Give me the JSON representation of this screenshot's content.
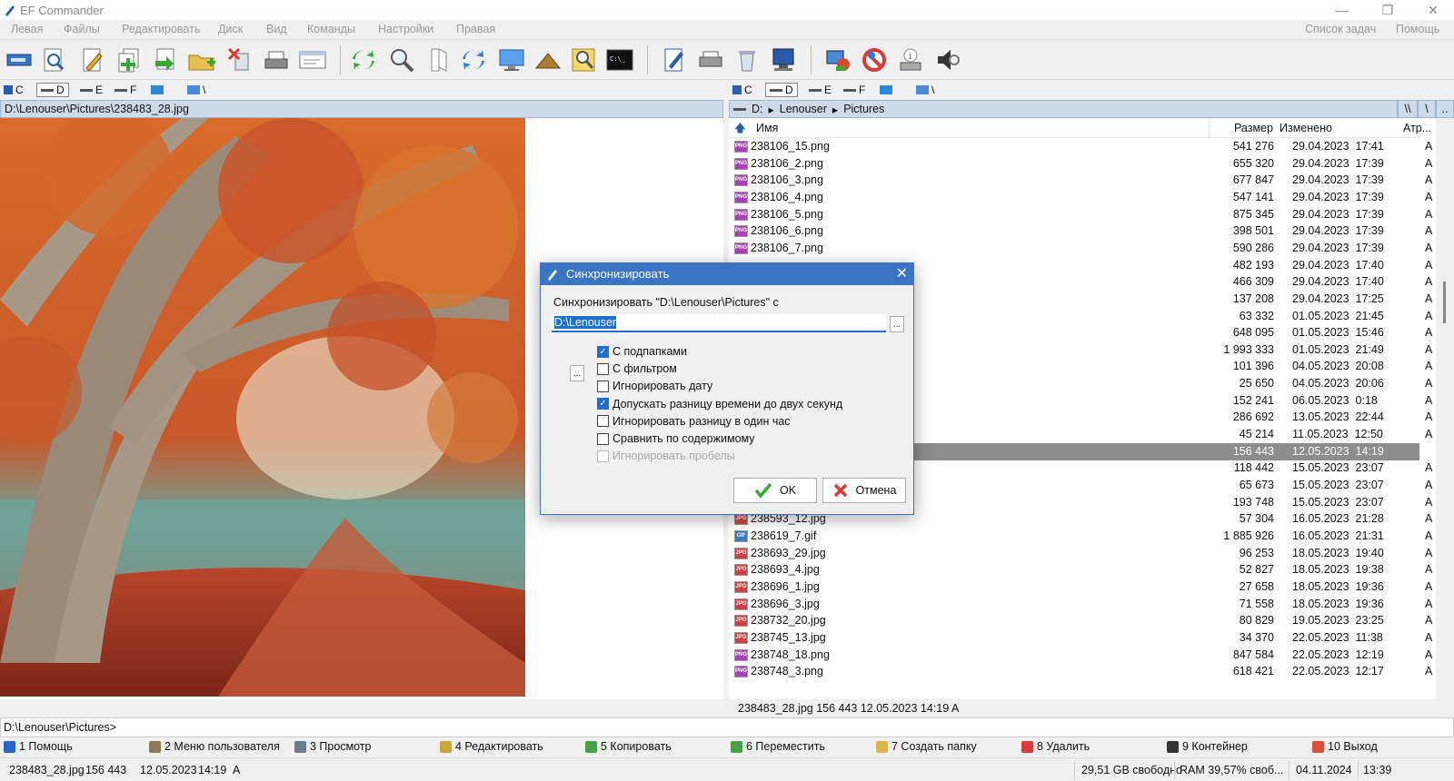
{
  "window": {
    "title": "EF Commander",
    "minimize": "—",
    "maximize": "❐",
    "close": "✕"
  },
  "menu": {
    "left": [
      "Левая",
      "Файлы",
      "Редактировать",
      "Диск",
      "Вид",
      "Команды",
      "Настройки",
      "Правая"
    ],
    "right": [
      "Список задач",
      "Помощь"
    ]
  },
  "drives": {
    "left": [
      {
        "label": "C"
      },
      {
        "label": "D"
      },
      {
        "label": "E"
      },
      {
        "label": "F"
      },
      {
        "label": ""
      },
      {
        "label": "\\"
      }
    ],
    "right": [
      {
        "label": "C"
      },
      {
        "label": "D"
      },
      {
        "label": "E"
      },
      {
        "label": "F"
      },
      {
        "label": ""
      },
      {
        "label": "\\"
      }
    ]
  },
  "left_panel": {
    "path": "D:\\Lenouser\\Pictures\\238483_28.jpg"
  },
  "right_panel": {
    "breadcrumb": [
      "D:",
      "Lenouser",
      "Pictures"
    ],
    "nav_buttons": [
      "\\\\",
      "\\",
      ".."
    ],
    "columns": {
      "name": "Имя",
      "size": "Размер",
      "modified": "Изменено",
      "attr": "Атр..."
    },
    "files": [
      {
        "type": "PNG",
        "name": "238106_15.png",
        "size": "541 276",
        "date": "29.04.2023",
        "time": "17:41",
        "attr": "A"
      },
      {
        "type": "PNG",
        "name": "238106_2.png",
        "size": "655 320",
        "date": "29.04.2023",
        "time": "17:39",
        "attr": "A"
      },
      {
        "type": "PNG",
        "name": "238106_3.png",
        "size": "677 847",
        "date": "29.04.2023",
        "time": "17:39",
        "attr": "A"
      },
      {
        "type": "PNG",
        "name": "238106_4.png",
        "size": "547 141",
        "date": "29.04.2023",
        "time": "17:39",
        "attr": "A"
      },
      {
        "type": "PNG",
        "name": "238106_5.png",
        "size": "875 345",
        "date": "29.04.2023",
        "time": "17:39",
        "attr": "A"
      },
      {
        "type": "PNG",
        "name": "238106_6.png",
        "size": "398 501",
        "date": "29.04.2023",
        "time": "17:39",
        "attr": "A"
      },
      {
        "type": "PNG",
        "name": "238106_7.png",
        "size": "590 286",
        "date": "29.04.2023",
        "time": "17:39",
        "attr": "A"
      },
      {
        "type": "",
        "name": "",
        "size": "482 193",
        "date": "29.04.2023",
        "time": "17:40",
        "attr": "A"
      },
      {
        "type": "",
        "name": "",
        "size": "466 309",
        "date": "29.04.2023",
        "time": "17:40",
        "attr": "A"
      },
      {
        "type": "",
        "name": "",
        "size": "137 208",
        "date": "29.04.2023",
        "time": "17:25",
        "attr": "A"
      },
      {
        "type": "",
        "name": "",
        "size": "63 332",
        "date": "01.05.2023",
        "time": "21:45",
        "attr": "A"
      },
      {
        "type": "",
        "name": "",
        "size": "648 095",
        "date": "01.05.2023",
        "time": "15:46",
        "attr": "A"
      },
      {
        "type": "",
        "name": "",
        "size": "1 993 333",
        "date": "01.05.2023",
        "time": "21:49",
        "attr": "A"
      },
      {
        "type": "",
        "name": "",
        "size": "101 396",
        "date": "04.05.2023",
        "time": "20:08",
        "attr": "A"
      },
      {
        "type": "",
        "name": "",
        "size": "25 650",
        "date": "04.05.2023",
        "time": "20:06",
        "attr": "A"
      },
      {
        "type": "",
        "name": "",
        "size": "152 241",
        "date": "06.05.2023",
        "time": "0:18",
        "attr": "A"
      },
      {
        "type": "",
        "name": "",
        "size": "286 692",
        "date": "13.05.2023",
        "time": "22:44",
        "attr": "A"
      },
      {
        "type": "",
        "name": "",
        "size": "45 214",
        "date": "11.05.2023",
        "time": "12:50",
        "attr": "A"
      },
      {
        "type": "",
        "name": "",
        "size": "156 443",
        "date": "12.05.2023",
        "time": "14:19",
        "attr": "A",
        "selected": true
      },
      {
        "type": "",
        "name": "",
        "size": "118 442",
        "date": "15.05.2023",
        "time": "23:07",
        "attr": "A"
      },
      {
        "type": "",
        "name": "",
        "size": "65 673",
        "date": "15.05.2023",
        "time": "23:07",
        "attr": "A"
      },
      {
        "type": "",
        "name": "",
        "size": "193 748",
        "date": "15.05.2023",
        "time": "23:07",
        "attr": "A"
      },
      {
        "type": "JPG",
        "name": "238593_12.jpg",
        "size": "57 304",
        "date": "16.05.2023",
        "time": "21:28",
        "attr": "A"
      },
      {
        "type": "GIF",
        "name": "238619_7.gif",
        "size": "1 885 926",
        "date": "16.05.2023",
        "time": "21:31",
        "attr": "A"
      },
      {
        "type": "JPG",
        "name": "238693_29.jpg",
        "size": "96 253",
        "date": "18.05.2023",
        "time": "19:40",
        "attr": "A"
      },
      {
        "type": "JPG",
        "name": "238693_4.jpg",
        "size": "52 827",
        "date": "18.05.2023",
        "time": "19:38",
        "attr": "A"
      },
      {
        "type": "JPG",
        "name": "238696_1.jpg",
        "size": "27 658",
        "date": "18.05.2023",
        "time": "19:36",
        "attr": "A"
      },
      {
        "type": "JPG",
        "name": "238696_3.jpg",
        "size": "71 558",
        "date": "18.05.2023",
        "time": "19:36",
        "attr": "A"
      },
      {
        "type": "JPG",
        "name": "238732_20.jpg",
        "size": "80 829",
        "date": "19.05.2023",
        "time": "23:25",
        "attr": "A"
      },
      {
        "type": "JPG",
        "name": "238745_13.jpg",
        "size": "34 370",
        "date": "22.05.2023",
        "time": "11:38",
        "attr": "A"
      },
      {
        "type": "PNG",
        "name": "238748_18.png",
        "size": "847 584",
        "date": "22.05.2023",
        "time": "12:19",
        "attr": "A"
      },
      {
        "type": "PNG",
        "name": "238748_3.png",
        "size": "618 421",
        "date": "22.05.2023",
        "time": "12:17",
        "attr": "A"
      }
    ],
    "status": "238483_28.jpg    156 443  12.05.2023  14:19  A"
  },
  "command_line": "D:\\Lenouser\\Pictures>",
  "fkeys": [
    {
      "label": "1 Помощь",
      "color": "#2a63c8"
    },
    {
      "label": "2 Меню пользователя",
      "color": "#8a7b5a"
    },
    {
      "label": "3 Просмотр",
      "color": "#6c7a8c"
    },
    {
      "label": "4 Редактировать",
      "color": "#c8a83a"
    },
    {
      "label": "5 Копировать",
      "color": "#4aa04a"
    },
    {
      "label": "6 Переместить",
      "color": "#4aa04a"
    },
    {
      "label": "7 Создать папку",
      "color": "#d8b84a"
    },
    {
      "label": "8 Удалить",
      "color": "#d83a3a"
    },
    {
      "label": "9 Контейнер",
      "color": "#333333"
    },
    {
      "label": "10 Выход",
      "color": "#d8503a"
    }
  ],
  "statusbar": {
    "file": "238483_28.jpg",
    "size": "156 443",
    "date": "12.05.2023",
    "time": "14:19",
    "attr": "A",
    "free": "29,51 GB свободно",
    "ram": "RAM 39,57% своб...",
    "today": "04.11.2024",
    "clock": "13:39"
  },
  "dialog": {
    "title": "Синхронизировать",
    "prompt": "Синхронизировать \"D:\\Lenouser\\Pictures\" с",
    "path_value": "D:\\Lenouser",
    "browse": "...",
    "filter_btn": "...",
    "options": [
      {
        "label": "С подпапками",
        "checked": true,
        "disabled": false
      },
      {
        "label": "С фильтром",
        "checked": false,
        "disabled": false
      },
      {
        "label": "Игнорировать дату",
        "checked": false,
        "disabled": false
      },
      {
        "label": "Допускать разницу времени до двух секунд",
        "checked": true,
        "disabled": false
      },
      {
        "label": "Игнорировать разницу в один час",
        "checked": false,
        "disabled": false
      },
      {
        "label": "Сравнить по содержимому",
        "checked": false,
        "disabled": false
      },
      {
        "label": "Игнорировать пробелы",
        "checked": false,
        "disabled": true
      }
    ],
    "ok": "OK",
    "cancel": "Отмена"
  },
  "colors": {
    "accent": "#3a74c4",
    "pathbar": "#cddbea",
    "selection": "#8d8d8d",
    "png_icon": "#b03cc0",
    "jpg_icon": "#d04040",
    "gif_icon": "#3a7ac0"
  }
}
